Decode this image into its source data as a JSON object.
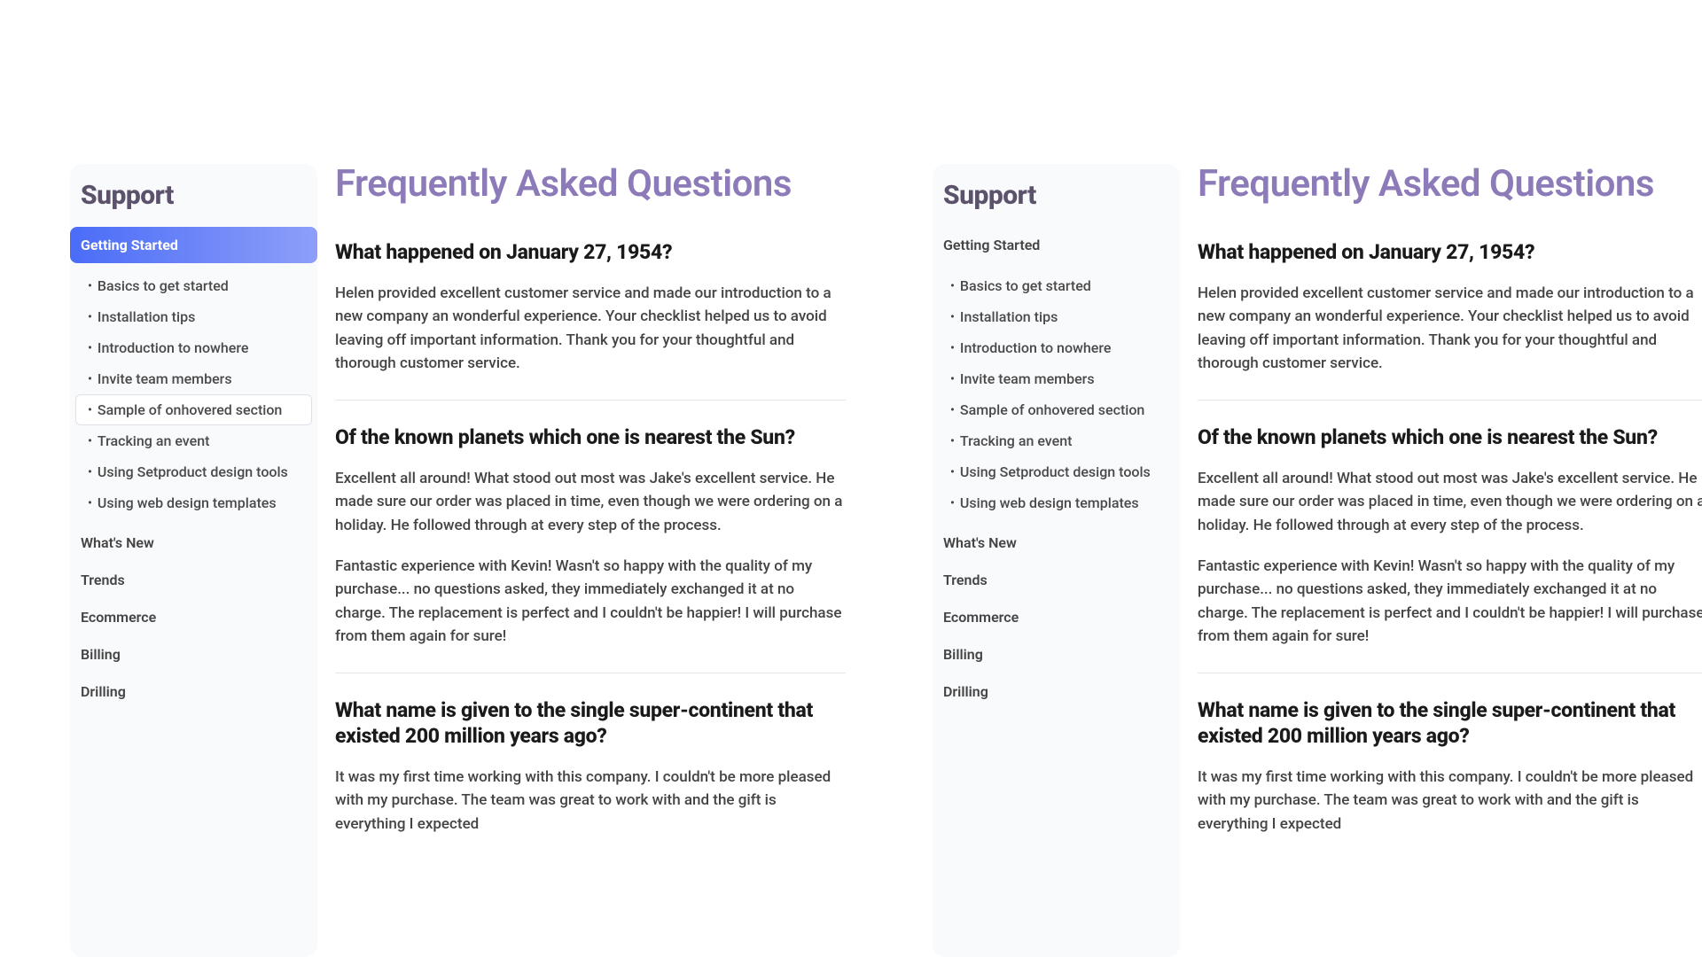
{
  "sidebar": {
    "title": "Support",
    "sections": [
      {
        "label": "Getting Started",
        "active": true
      },
      {
        "label": "What's New",
        "active": false
      },
      {
        "label": "Trends",
        "active": false
      },
      {
        "label": "Ecommerce",
        "active": false
      },
      {
        "label": "Billing",
        "active": false
      },
      {
        "label": "Drilling",
        "active": false
      }
    ],
    "sub_items": [
      {
        "label": "Basics to get started"
      },
      {
        "label": "Installation tips"
      },
      {
        "label": "Introduction to nowhere"
      },
      {
        "label": "Invite team members"
      },
      {
        "label": "Sample of onhovered section"
      },
      {
        "label": "Tracking an event"
      },
      {
        "label": "Using Setproduct design tools"
      },
      {
        "label": "Using web design templates"
      }
    ]
  },
  "main": {
    "title": "Frequently Asked Questions",
    "faqs": [
      {
        "question": "What happened on January 27, 1954?",
        "answer_p1": "Helen provided excellent customer service and made our introduction to a new company an wonderful experience. Your checklist helped us to avoid leaving off important information. Thank you for your thoughtful and thorough customer service."
      },
      {
        "question": "Of the known planets which one is nearest the Sun?",
        "answer_p1": "Excellent all around! What stood out most was Jake's excellent service. He made sure our order was placed in time, even though we were ordering on a holiday. He followed through at every step of the process.",
        "answer_p2": "Fantastic experience with Kevin! Wasn't so happy with the quality of my purchase... no questions asked, they immediately exchanged it at no charge. The replacement is perfect and I couldn't be happier! I will purchase from them again for sure!"
      },
      {
        "question": "What name is given to the single super-continent that existed 200 million years ago?",
        "answer_p1": "It was my first time working with this company. I couldn't be more pleased with my purchase. The team was great to work with and the gift is everything I expected"
      }
    ]
  },
  "main2": {
    "title": "Freque",
    "faqs": [
      {
        "question": "What happe",
        "answer_p1": "Helen provided company an wo important infor service."
      },
      {
        "question": "Of the know",
        "answer_p1": "Excellent all arc sure our order w followed throug",
        "answer_p2": "Fantastic exper no questions as is perfect and I"
      },
      {
        "question": "What name 200 million",
        "answer_p1": "It was my first purchase"
      }
    ]
  }
}
